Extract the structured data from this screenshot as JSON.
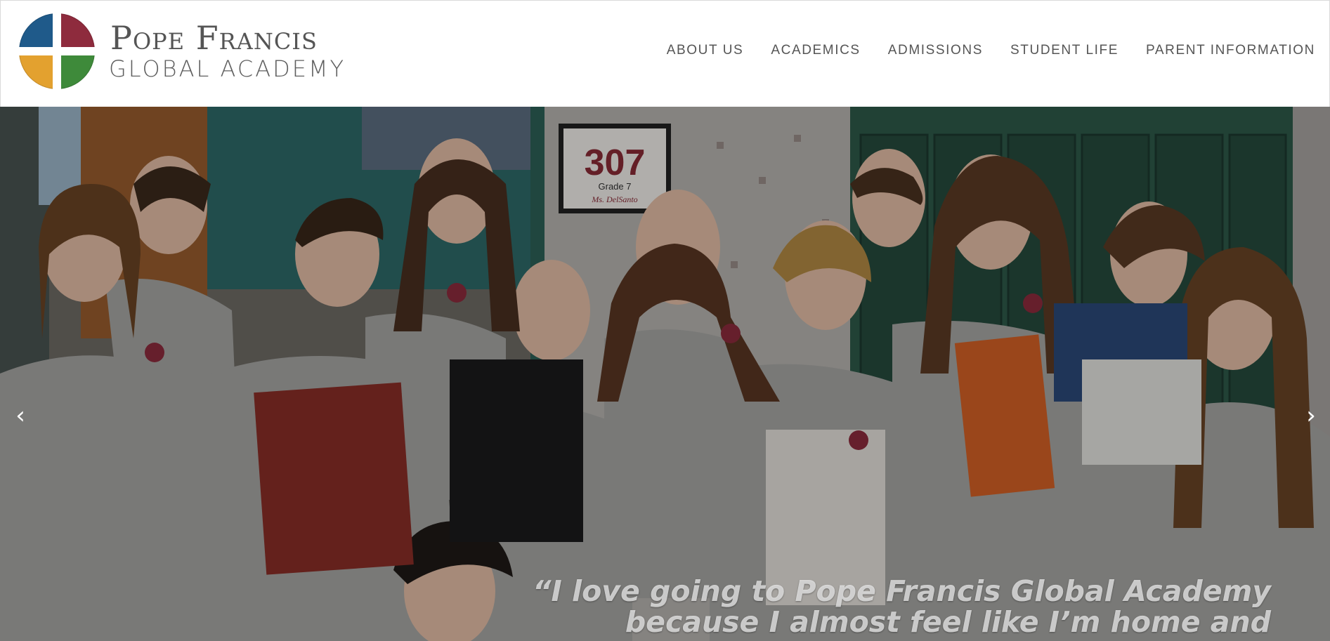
{
  "header": {
    "logo": {
      "line1": "Pope Francis",
      "line2": "GLOBAL ACADEMY",
      "colors": {
        "top_left": "#1f5a8a",
        "top_right": "#8e2b3d",
        "bottom_left": "#e3a12f",
        "bottom_right": "#3e8a3a",
        "cross": "#ffffff"
      }
    },
    "nav": [
      {
        "label": "ABOUT US"
      },
      {
        "label": "ACADEMICS"
      },
      {
        "label": "ADMISSIONS"
      },
      {
        "label": "STUDENT LIFE"
      },
      {
        "label": "PARENT INFORMATION"
      }
    ]
  },
  "hero": {
    "classroom_sign": {
      "number": "307",
      "grade": "Grade 7",
      "teacher": "Ms. DelSanto"
    },
    "quote_line1": "“I love going to Pope Francis Global Academy",
    "quote_line2": "because I almost feel like I’m home and",
    "prev_icon": "‹",
    "next_icon": "›"
  }
}
